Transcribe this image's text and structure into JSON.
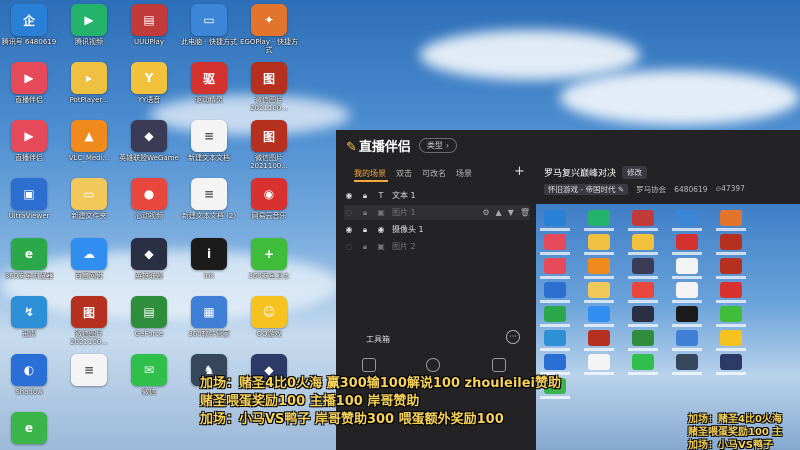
{
  "desktop_icons": [
    {
      "label": "腾讯号\n6480619",
      "color": "#2a7fd6",
      "glyph": "企"
    },
    {
      "label": "腾讯视频",
      "color": "#23b36b",
      "glyph": "▶"
    },
    {
      "label": "UUUPlay",
      "color": "#c23b3b",
      "glyph": "▤"
    },
    {
      "label": "此电脑 - 快捷方式",
      "color": "#3b86d6",
      "glyph": "▭"
    },
    {
      "label": "EGOPlay - 快捷方式",
      "color": "#e2742b",
      "glyph": "✦"
    },
    {
      "label": "直播伴侣",
      "color": "#e64a5a",
      "glyph": "▶"
    },
    {
      "label": "PotPlayer...",
      "color": "#f0c040",
      "glyph": "▸"
    },
    {
      "label": "YY语音",
      "color": "#f3c23d",
      "glyph": "Y"
    },
    {
      "label": "驱动精灵",
      "color": "#d3322f",
      "glyph": "驱"
    },
    {
      "label": "微信图片 2021100...",
      "color": "#b5301f",
      "glyph": "图"
    },
    {
      "label": "直播伴侣",
      "color": "#e64a5a",
      "glyph": "▶"
    },
    {
      "label": "VLC_Medi...",
      "color": "#f08a1c",
      "glyph": "▲"
    },
    {
      "label": "英雄联盟WeGame",
      "color": "#3b3b55",
      "glyph": "◆"
    },
    {
      "label": "新建文本文档",
      "color": "#f4f4f4",
      "glyph": "≡"
    },
    {
      "label": "微信图片 2021100...",
      "color": "#b5301f",
      "glyph": "图"
    },
    {
      "label": "UltraViewer",
      "color": "#2c6fd0",
      "glyph": "▣"
    },
    {
      "label": "新建文件夹",
      "color": "#f3c85a",
      "glyph": "▭"
    },
    {
      "label": "心动视频",
      "color": "#e8473d",
      "glyph": "●"
    },
    {
      "label": "新建文本文档 (2)",
      "color": "#f4f4f4",
      "glyph": "≡"
    },
    {
      "label": "网易云音乐",
      "color": "#d8312f",
      "glyph": "◉"
    },
    {
      "label": "360安全浏览器",
      "color": "#2aa84a",
      "glyph": "e"
    },
    {
      "label": "百度网盘",
      "color": "#2f8ef0",
      "glyph": "☁"
    },
    {
      "label": "英雄联盟",
      "color": "#2b2f44",
      "glyph": "◆"
    },
    {
      "label": "ink",
      "color": "#1b1b1b",
      "glyph": "i"
    },
    {
      "label": "360安全卫士",
      "color": "#3ebc3a",
      "glyph": "+"
    },
    {
      "label": "迅雷",
      "color": "#2d8fd6",
      "glyph": "↯"
    },
    {
      "label": "微信图片 2021100...",
      "color": "#b5301f",
      "glyph": "图"
    },
    {
      "label": "GeForce",
      "color": "#2f8e3b",
      "glyph": "▤"
    },
    {
      "label": "360软件管家",
      "color": "#3f7fd6",
      "glyph": "▦"
    },
    {
      "label": "QQ游戏",
      "color": "#f5c21f",
      "glyph": "☺"
    },
    {
      "label": "Shadow",
      "color": "#2a6fd6",
      "glyph": "◐"
    },
    {
      "label": "",
      "color": "#f4f4f4",
      "glyph": "≡"
    },
    {
      "label": "微信",
      "color": "#2fbf4a",
      "glyph": "✉"
    },
    {
      "label": "",
      "color": "#37475b",
      "glyph": "♞"
    },
    {
      "label": "",
      "color": "#2b3a66",
      "glyph": "◆"
    },
    {
      "label": "",
      "color": "#3ab54a",
      "glyph": "e"
    }
  ],
  "app": {
    "logo_text": "直播伴侣",
    "type_button": "类型",
    "scene_tabs": [
      "我的场景",
      "双击",
      "可改名",
      "场景"
    ],
    "add_scene": "+",
    "sources": [
      {
        "name": "文本 1",
        "type_glyph": "T",
        "visible": true
      },
      {
        "name": "图片 1",
        "type_glyph": "▣",
        "visible": false
      },
      {
        "name": "摄像头 1",
        "type_glyph": "◉",
        "visible": true
      },
      {
        "name": "图片 2",
        "type_glyph": "▣",
        "visible": false
      }
    ],
    "tools_label": "工具箱",
    "tools_more": "···",
    "room_title": "罗马复兴巅峰对决",
    "edit_button": "修改",
    "category": "怀旧游戏 - 帝国时代",
    "room_name": "罗马协会",
    "room_id": "6480619",
    "viewers": "47397"
  },
  "captions": {
    "line1": "加场：赌圣4比0火海 赢300输100解说100 zhouleilei赞助",
    "line2": "赌圣喂蛋奖励100 主播100 岸哥赞助",
    "line3": "加场：小马VS鸭子 岸哥赞助300 喂蛋额外奖励100",
    "preview_line1": "加场：赌圣4比0火海",
    "preview_line2": "赌圣喂蛋奖励100 主",
    "preview_line3": "加场：小马VS鸭子"
  },
  "colors": {
    "caption": "#f7d25a",
    "app_bg": "#232326",
    "accent": "#f5a93c"
  }
}
